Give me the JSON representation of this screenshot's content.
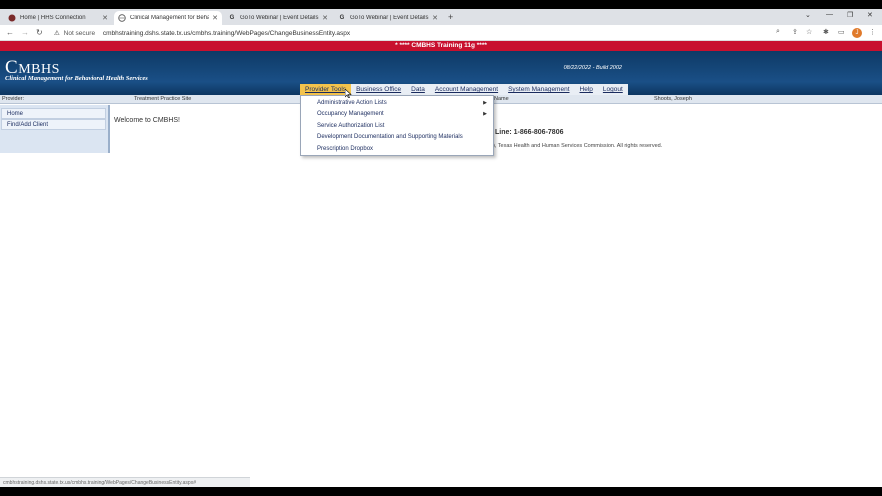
{
  "browser": {
    "tabs": [
      {
        "title": "Home | HHS Connection",
        "icon": "hhs-favicon",
        "active": false
      },
      {
        "title": "Clinical Management for Behavio",
        "icon": "globe-favicon",
        "active": true
      },
      {
        "title": "GoTo Webinar | Event Details",
        "icon": "goto-favicon",
        "active": false
      },
      {
        "title": "GoTo Webinar | Event Details",
        "icon": "goto-favicon",
        "active": false
      }
    ],
    "new_tab": "+",
    "security_label": "Not secure",
    "url": "cmbhstraining.dshs.state.tx.us/cmbhs.training/WebPages/ChangeBusinessEntity.aspx",
    "profile_initial": "J"
  },
  "app": {
    "banner": "* **** CMBHS Training 11g ****",
    "logo_initial": "C",
    "logo_rest": "MBHS",
    "logo_subtitle": "Clinical Management for Behavioral Health Services",
    "build": "08/22/2022 - Build 2002",
    "menu": [
      {
        "label": "Provider Tools",
        "open": true
      },
      {
        "label": "Business Office"
      },
      {
        "label": "Data"
      },
      {
        "label": "Account Management"
      },
      {
        "label": "System Management"
      },
      {
        "label": "Help"
      },
      {
        "label": "Logout"
      }
    ],
    "info_strip": {
      "provider_label": "Provider:",
      "site_label": "Treatment Practice Site",
      "name_label": "Name",
      "user_name": "Shoots, Joseph"
    },
    "sidebar": [
      {
        "label": "Home"
      },
      {
        "label": "Find/Add Client"
      }
    ],
    "welcome": "Welcome to CMBHS!",
    "hotline": "Line: 1-866-806-7806",
    "copyright": "), Texas Health and Human Services Commission. All rights reserved.",
    "dropdown": [
      {
        "label": "Administrative Action Lists",
        "has_submenu": true
      },
      {
        "label": "Occupancy Management",
        "has_submenu": true
      },
      {
        "label": "Service Authorization List",
        "has_submenu": false
      },
      {
        "label": "Development Documentation and Supporting Materials",
        "has_submenu": false
      },
      {
        "label": "Prescription Dropbox",
        "has_submenu": false
      }
    ],
    "status_url": "cmbhstraining.dshs.state.tx.us/cmbhs.training/WebPages/ChangeBusinessEntity.aspx#"
  },
  "colors": {
    "banner": "#c8102e",
    "header": "#1a4f86",
    "menu_active": "#f3c34c"
  }
}
